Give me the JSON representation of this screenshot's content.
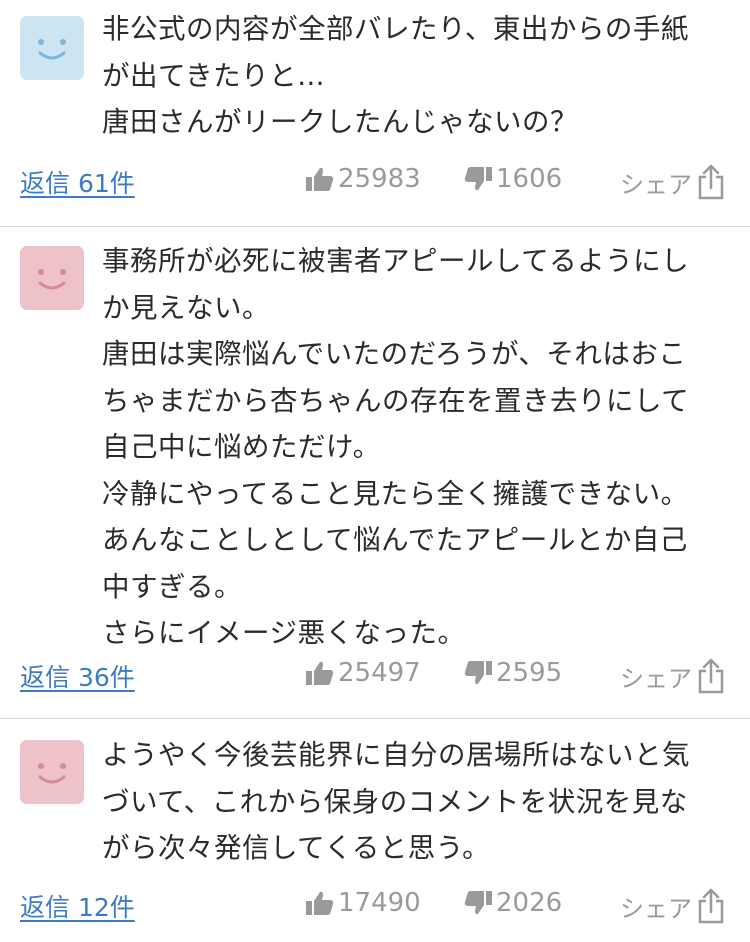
{
  "comments": [
    {
      "avatar_color": "#cde4f3",
      "text": "非公式の内容が全部バレたり、東出からの手紙\nが出てきたりと…\n唐田さんがリークしたんじゃないの？",
      "reply_label": "返信 61件",
      "likes": "25983",
      "dislikes": "1606",
      "share_label": "シェア"
    },
    {
      "avatar_color": "#edc3c9",
      "text": "事務所が必死に被害者アピールしてるようにし\nか見えない。\n唐田は実際悩んでいたのだろうが、それはおこ\nちゃまだから杏ちゃんの存在を置き去りにして\n自己中に悩めただけ。\n冷静にやってること見たら全く擁護できない。\nあんなことしとして悩んでたアピールとか自己\n中すぎる。\nさらにイメージ悪くなった。",
      "reply_label": "返信 36件",
      "likes": "25497",
      "dislikes": "2595",
      "share_label": "シェア"
    },
    {
      "avatar_color": "#edc3c9",
      "text": "ようやく今後芸能界に自分の居場所はないと気\nづいて、これから保身のコメントを状況を見な\nがら次々発信してくると思う。",
      "reply_label": "返信 12件",
      "likes": "17490",
      "dislikes": "2026",
      "share_label": "シェア"
    }
  ]
}
